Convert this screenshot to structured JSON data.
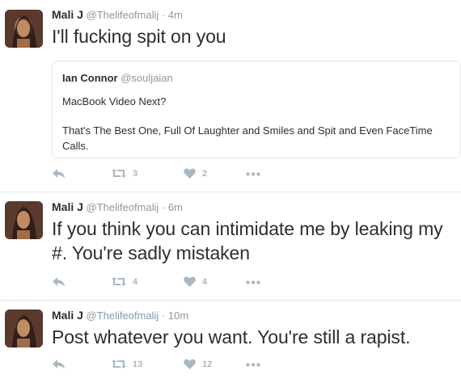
{
  "tweets": [
    {
      "name": "Mali J",
      "handle": "@Thelifeofmalij",
      "separator": "·",
      "time": "4m",
      "text": "I'll fucking spit on you",
      "quote": {
        "name": "Ian Connor",
        "handle": "@souljaian",
        "line1": "MacBook Video Next?",
        "line2": "That's The Best One, Full Of Laughter and Smiles and Spit and Even FaceTime Calls."
      },
      "retweets": "3",
      "likes": "2"
    },
    {
      "name": "Mali J",
      "handle": "@Thelifeofmalij",
      "separator": "·",
      "time": "6m",
      "text": "If you think you can intimidate me by leaking my #. You're sadly mistaken",
      "retweets": "4",
      "likes": "4"
    },
    {
      "name": "Mali J",
      "handle": "@Thelifeofmalij",
      "separator": "·",
      "time": "10m",
      "text": "Post whatever you want. You're still a rapist.",
      "retweets": "13",
      "likes": "12"
    }
  ],
  "icons": {
    "reply": "reply-icon",
    "retweet": "retweet-icon",
    "like": "heart-icon",
    "more": "more-icon"
  },
  "colors": {
    "muted": "#8899a6",
    "action": "#aab8c2",
    "divider": "#e1e8ed"
  }
}
